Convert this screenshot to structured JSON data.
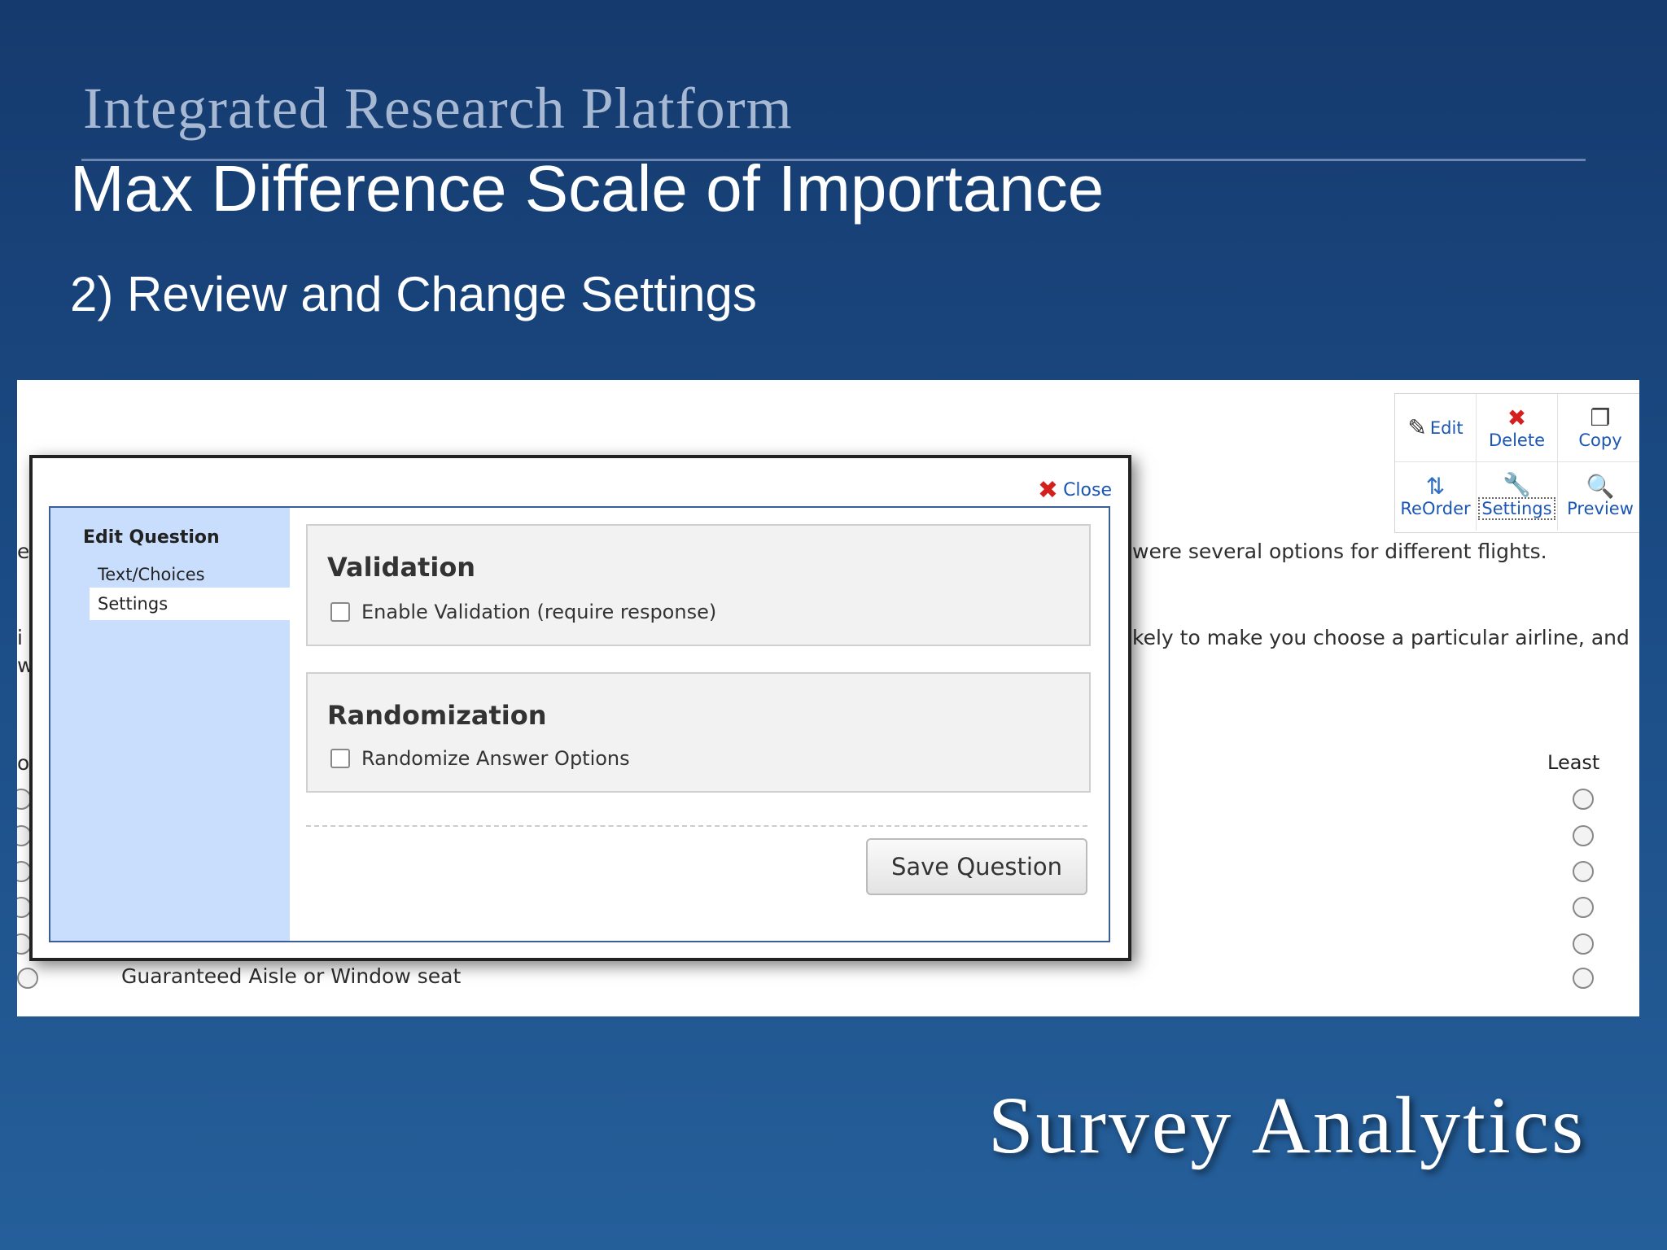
{
  "slide": {
    "platform_title": "Integrated Research Platform",
    "title": "Max Difference Scale of Importance",
    "subtitle": "2) Review and Change Settings",
    "brand": "Survey Analytics"
  },
  "toolbar": {
    "edit": "Edit",
    "delete": "Delete",
    "copy": "Copy",
    "reorder": "ReOrder",
    "settings": "Settings",
    "preview": "Preview"
  },
  "background": {
    "fragment_1": "were several options for different flights.",
    "fragment_2": "kely to make you choose a particular airline, and",
    "column_least": "Least",
    "last_option": "Guaranteed Aisle or Window seat",
    "left_e": "e",
    "left_i": "i",
    "left_w": "w",
    "left_o": "o"
  },
  "modal": {
    "close": "Close",
    "sidebar_heading": "Edit Question",
    "sidebar_items": [
      "Text/Choices",
      "Settings"
    ],
    "validation_title": "Validation",
    "validation_option": "Enable Validation (require response)",
    "randomization_title": "Randomization",
    "randomization_option": "Randomize Answer Options",
    "save_button": "Save Question"
  },
  "colors": {
    "link_blue": "#1a56b4",
    "sidebar_blue": "#c9ddfd",
    "close_red": "#d41f1f"
  }
}
